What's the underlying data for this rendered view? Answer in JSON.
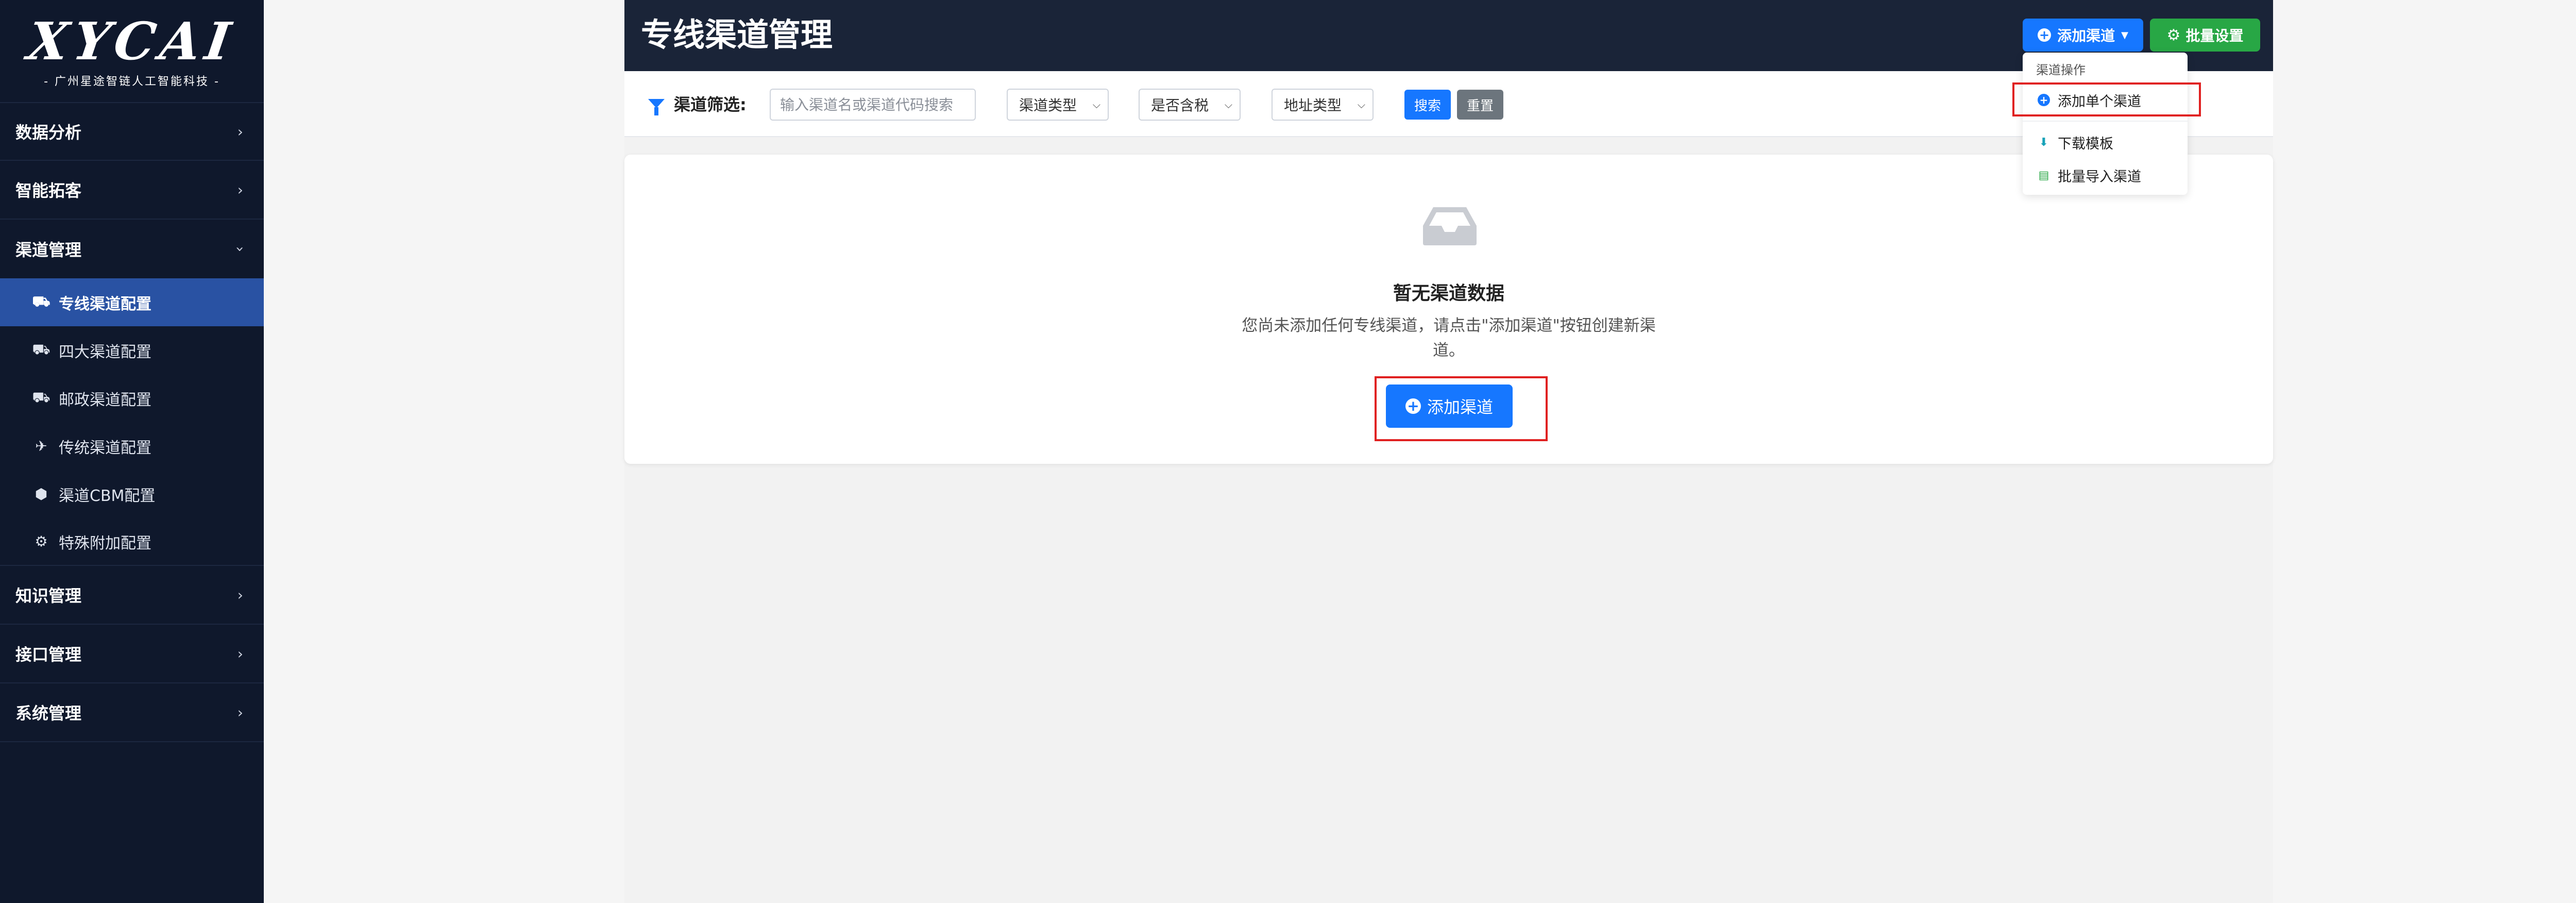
{
  "sidebar": {
    "logo_mark": "XYCAI",
    "logo_subtitle": "- 广州星途智链人工智能科技 -",
    "groups": [
      {
        "label": "数据分析",
        "icon": "chevron-right-icon"
      },
      {
        "label": "智能拓客",
        "icon": "chevron-right-icon"
      },
      {
        "label": "渠道管理",
        "icon": "chevron-down-icon"
      }
    ],
    "channel_items": [
      {
        "label": "专线渠道配置",
        "icon": "truck-icon",
        "active": true
      },
      {
        "label": "四大渠道配置",
        "icon": "truck-icon",
        "active": false
      },
      {
        "label": "邮政渠道配置",
        "icon": "truck-icon",
        "active": false
      },
      {
        "label": "传统渠道配置",
        "icon": "plane-icon",
        "active": false
      },
      {
        "label": "渠道CBM配置",
        "icon": "cube-icon",
        "active": false
      },
      {
        "label": "特殊附加配置",
        "icon": "gear-icon",
        "active": false
      }
    ],
    "groups_after": [
      {
        "label": "知识管理",
        "icon": "chevron-right-icon"
      },
      {
        "label": "接口管理",
        "icon": "chevron-right-icon"
      },
      {
        "label": "系统管理",
        "icon": "chevron-right-icon"
      }
    ]
  },
  "header": {
    "title": "专线渠道管理",
    "add_channel_label": "添加渠道",
    "batch_settings_label": "批量设置"
  },
  "filter": {
    "label": "渠道筛选:",
    "search_placeholder": "输入渠道名或渠道代码搜索",
    "select_type": "渠道类型",
    "select_tax": "是否含税",
    "select_address": "地址类型",
    "search_button": "搜索",
    "reset_button": "重置"
  },
  "empty_state": {
    "title": "暂无渠道数据",
    "description": "您尚未添加任何专线渠道，请点击\"添加渠道\"按钮创建新渠道。",
    "button_label": "添加渠道"
  },
  "dropdown": {
    "header": "渠道操作",
    "items": [
      {
        "label": "添加单个渠道",
        "icon": "plus-circle-icon"
      },
      {
        "label": "下载模板",
        "icon": "download-icon"
      },
      {
        "label": "批量导入渠道",
        "icon": "file-import-icon"
      }
    ]
  },
  "colors": {
    "sidebar_bg": "#0f182c",
    "active_item": "#2952a3",
    "primary": "#1677ff",
    "success": "#28a745",
    "secondary": "#6c757d",
    "highlight": "#e02020"
  }
}
